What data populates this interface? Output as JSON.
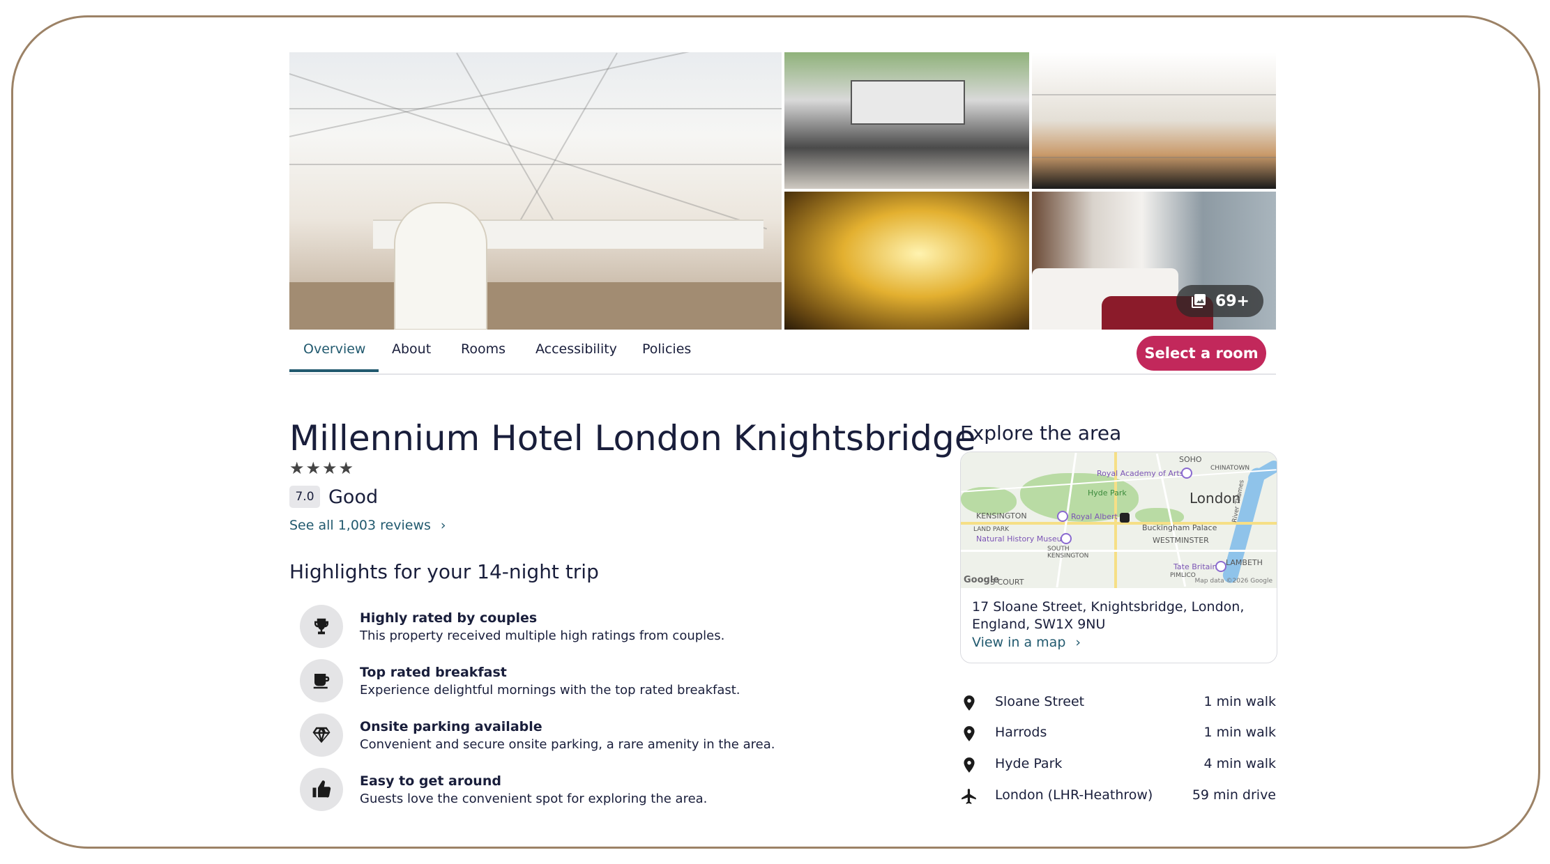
{
  "gallery": {
    "photo_count": "69+"
  },
  "tabs": [
    {
      "label": "Overview"
    },
    {
      "label": "About"
    },
    {
      "label": "Rooms"
    },
    {
      "label": "Accessibility"
    },
    {
      "label": "Policies"
    }
  ],
  "select_room_label": "Select a room",
  "hotel": {
    "name": "Millennium Hotel London Knightsbridge",
    "stars": "★★★★",
    "score": "7.0",
    "score_label": "Good",
    "reviews_link": "See all 1,003 reviews"
  },
  "highlights": {
    "title": "Highlights for your 14-night trip",
    "items": [
      {
        "icon": "trophy-icon",
        "title": "Highly rated by couples",
        "desc": "This property received multiple high ratings from couples."
      },
      {
        "icon": "coffee-cup-icon",
        "title": "Top rated breakfast",
        "desc": "Experience delightful mornings with the top rated breakfast."
      },
      {
        "icon": "diamond-icon",
        "title": "Onsite parking available",
        "desc": "Convenient and secure onsite parking, a rare amenity in the area."
      },
      {
        "icon": "thumbs-up-icon",
        "title": "Easy to get around",
        "desc": "Guests love the convenient spot for exploring the area."
      }
    ]
  },
  "explore": {
    "title": "Explore the area",
    "map_labels": {
      "soho": "SOHO",
      "chinatown": "CHINATOWN",
      "royal_academy": "Royal Academy of Arts",
      "hyde_park": "Hyde Park",
      "london": "London",
      "kensington": "KENSINGTON",
      "royal_albert": "Royal Albert",
      "buckingham": "Buckingham Palace",
      "land_park": "LAND PARK",
      "natural_history": "Natural History Museum",
      "westminster": "WESTMINSTER",
      "south_kensington": "SOUTH KENSINGTON",
      "river_thames": "River Thames",
      "tate_britain": "Tate Britain",
      "lambeth": "LAMBETH",
      "pimlico": "PIMLICO",
      "earls_court": "S COURT",
      "google": "Google",
      "credit": "Map data ©2026 Google"
    },
    "address": "17 Sloane Street, Knightsbridge, London, England, SW1X 9NU",
    "map_link": "View in a map",
    "places": [
      {
        "icon": "map-pin-icon",
        "name": "Sloane Street",
        "distance": "1 min walk"
      },
      {
        "icon": "map-pin-icon",
        "name": "Harrods",
        "distance": "1 min walk"
      },
      {
        "icon": "map-pin-icon",
        "name": "Hyde Park",
        "distance": "4 min walk"
      },
      {
        "icon": "airplane-icon",
        "name": "London (LHR-Heathrow)",
        "distance": "59 min drive"
      }
    ]
  },
  "colors": {
    "primary": "#c2285b",
    "link": "#225a6f",
    "text": "#191e3b",
    "frame": "#9c8266"
  }
}
